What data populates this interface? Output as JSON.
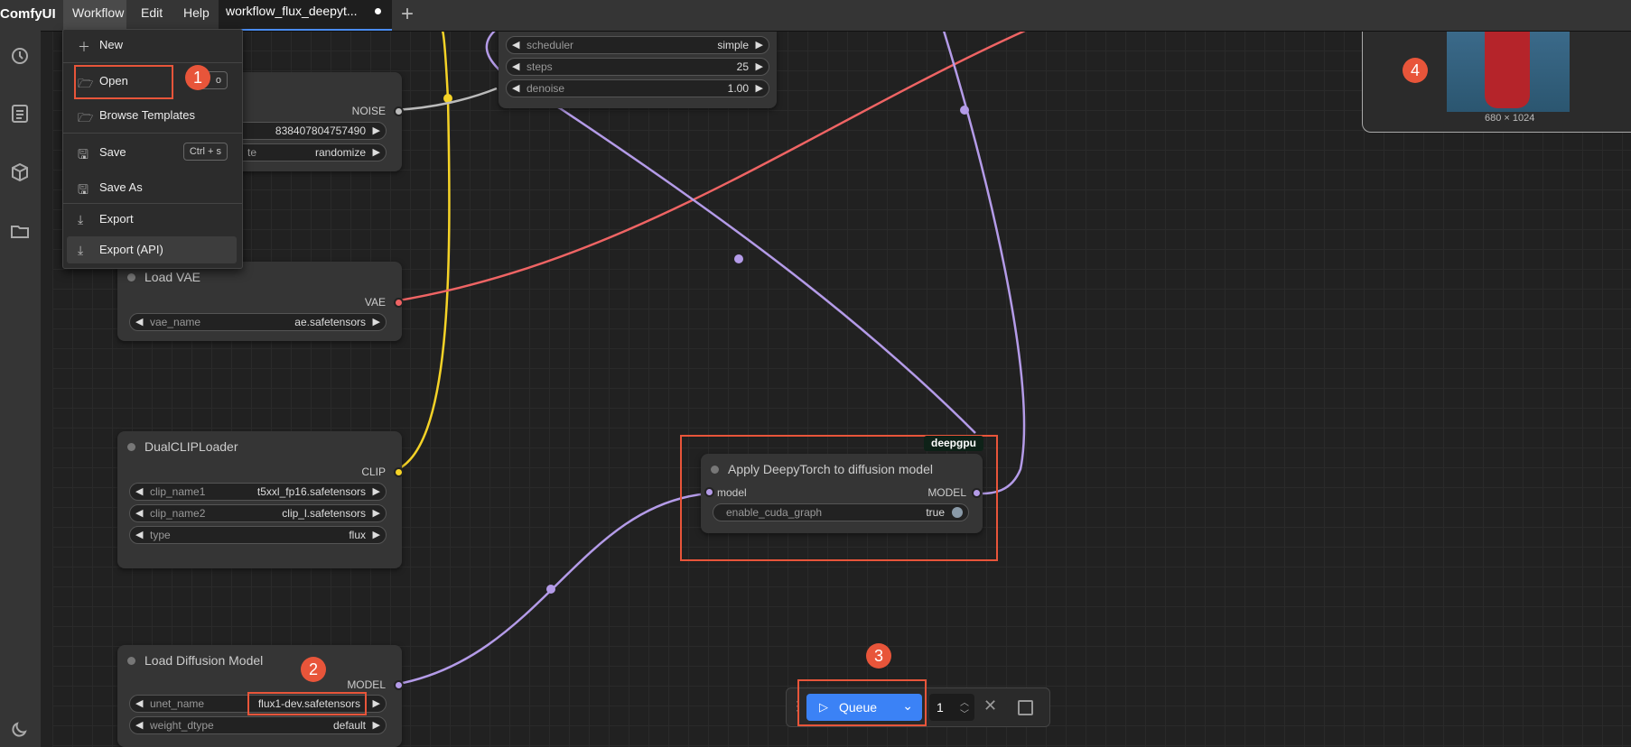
{
  "topbar": {
    "brand": "ComfyUI",
    "menus": [
      "Workflow",
      "Edit",
      "Help"
    ],
    "tab_title": "workflow_flux_deepyt...",
    "new_tab": "+"
  },
  "dropdown": {
    "items": [
      {
        "label": "New",
        "shortcut": ""
      },
      {
        "label": "Open",
        "shortcut": "o"
      },
      {
        "label": "Browse Templates",
        "shortcut": ""
      },
      {
        "label": "Save",
        "shortcut": "Ctrl + s"
      },
      {
        "label": "Save As",
        "shortcut": ""
      },
      {
        "label": "Export",
        "shortcut": ""
      },
      {
        "label": "Export (API)",
        "shortcut": ""
      }
    ]
  },
  "sampler_node": {
    "widgets": [
      {
        "name": "scheduler",
        "value": "simple"
      },
      {
        "name": "steps",
        "value": "25"
      },
      {
        "name": "denoise",
        "value": "1.00"
      }
    ]
  },
  "noise_node": {
    "output": "NOISE",
    "seed_value": "838407804757490",
    "control_label": "te",
    "control_value": "randomize"
  },
  "vae_node": {
    "title": "Load VAE",
    "output": "VAE",
    "widget_name": "vae_name",
    "widget_value": "ae.safetensors"
  },
  "clip_node": {
    "title": "DualCLIPLoader",
    "output": "CLIP",
    "widgets": [
      {
        "name": "clip_name1",
        "value": "t5xxl_fp16.safetensors"
      },
      {
        "name": "clip_name2",
        "value": "clip_l.safetensors"
      },
      {
        "name": "type",
        "value": "flux"
      }
    ]
  },
  "diffusion_node": {
    "title": "Load Diffusion Model",
    "output": "MODEL",
    "widgets": [
      {
        "name": "unet_name",
        "value": "flux1-dev.safetensors"
      },
      {
        "name": "weight_dtype",
        "value": "default"
      }
    ]
  },
  "deepy_node": {
    "badge": "deepgpu",
    "title": "Apply DeepyTorch to diffusion model",
    "input": "model",
    "output": "MODEL",
    "widget_name": "enable_cuda_graph",
    "widget_value": "true"
  },
  "preview": {
    "size": "680 × 1024"
  },
  "queue": {
    "label": "Queue",
    "count": "1"
  },
  "annotations": [
    "1",
    "2",
    "3",
    "4"
  ],
  "colors": {
    "accent": "#3b82f6",
    "annotation": "#e8553a",
    "clip_link": "#f5d327",
    "vae_link": "#ef6464",
    "model_link": "#b49be8",
    "noise_link": "#bbbbbb"
  }
}
